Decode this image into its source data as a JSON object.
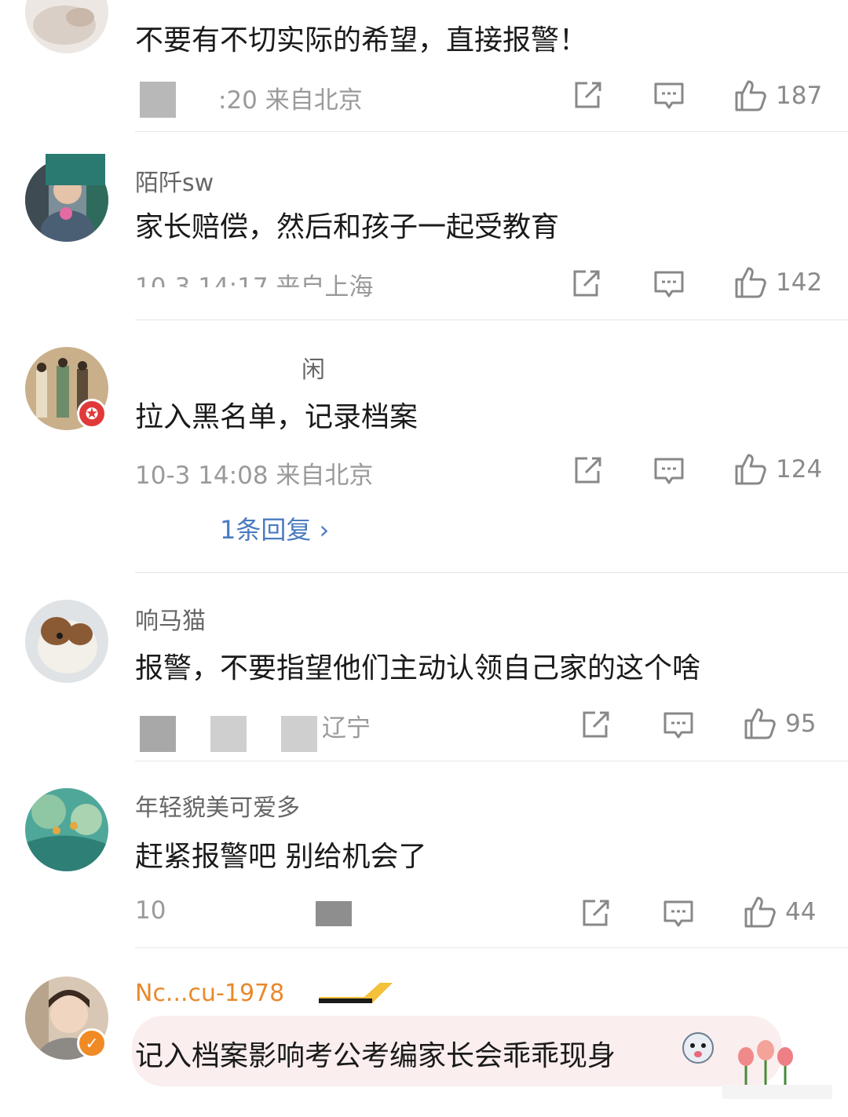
{
  "comments": [
    {
      "name": "",
      "text": "不要有不切实际的希望，直接报警！",
      "meta": ":20 来自北京",
      "likes": "187"
    },
    {
      "name": "陌阡sw",
      "text": "家长赔偿，然后和孩子一起受教育",
      "meta": "10-3 14:17 来自上海",
      "likes": "142"
    },
    {
      "name": "闲",
      "text": "拉入黑名单，记录档案",
      "meta": "10-3 14:08 来自北京",
      "likes": "124",
      "replies": "1条回复 ›"
    },
    {
      "name": "响马猫",
      "text": "报警，不要指望他们主动认领自己家的这个啥",
      "meta": "辽宁",
      "likes": "95"
    },
    {
      "name": "年轻貌美可爱多",
      "text": "赶紧报警吧 别给机会了",
      "meta": "10",
      "likes": "44"
    },
    {
      "name": "Nc...cu-1978",
      "text": "记入档案影响考公考编家长会乖乖现身",
      "meta": "",
      "likes": ""
    }
  ],
  "icons": {
    "share": "share-icon",
    "reply": "comment-icon",
    "like": "thumbs-up-icon"
  },
  "colors": {
    "link": "#4a7bc0",
    "meta": "#9a9a9a",
    "verified": "#f08a24",
    "vip_red": "#e0393a"
  }
}
